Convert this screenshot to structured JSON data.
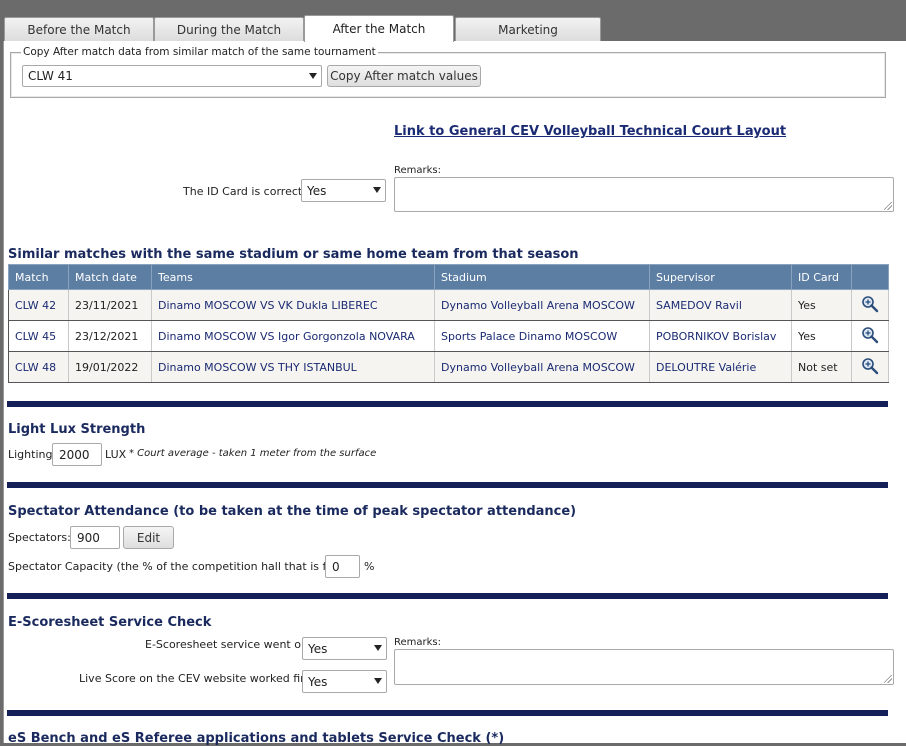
{
  "tabs": [
    {
      "label": "Before the Match"
    },
    {
      "label": "During the Match"
    },
    {
      "label": "After the Match"
    },
    {
      "label": "Marketing"
    }
  ],
  "copy_section": {
    "legend": "Copy After match data from similar match of the same tournament",
    "selected_match": "CLW 41",
    "button_label": "Copy After match values"
  },
  "court_layout_link": "Link to General CEV Volleyball Technical Court Layout",
  "id_card": {
    "label": "The ID Card is correct?",
    "value": "Yes",
    "remarks_label": "Remarks:"
  },
  "similar_matches": {
    "title": "Similar matches with the same stadium or same home team from that season",
    "columns": [
      "Match",
      "Match date",
      "Teams",
      "Stadium",
      "Supervisor",
      "ID Card"
    ],
    "rows": [
      {
        "match": "CLW 42",
        "date": "23/11/2021",
        "teams": "Dinamo MOSCOW VS VK Dukla LIBEREC",
        "stadium": "Dynamo Volleyball Arena MOSCOW",
        "supervisor": "SAMEDOV Ravil",
        "id_card": "Yes"
      },
      {
        "match": "CLW 45",
        "date": "23/12/2021",
        "teams": "Dinamo MOSCOW VS Igor Gorgonzola NOVARA",
        "stadium": "Sports Palace Dinamo MOSCOW",
        "supervisor": "POBORNIKOV Borislav",
        "id_card": "Yes"
      },
      {
        "match": "CLW 48",
        "date": "19/01/2022",
        "teams": "Dinamo MOSCOW VS THY ISTANBUL",
        "stadium": "Dynamo Volleyball Arena MOSCOW",
        "supervisor": "DELOUTRE Valérie",
        "id_card": "Not set"
      }
    ]
  },
  "light": {
    "title": "Light Lux Strength",
    "label": "Lighting",
    "value": "2000",
    "unit": "LUX",
    "note": "* Court average - taken 1 meter from the surface"
  },
  "spectators": {
    "title": "Spectator Attendance (to be taken at the time of peak spectator attendance)",
    "label": "Spectators:",
    "value": "900",
    "edit_label": "Edit",
    "capacity_label": "Spectator Capacity (the % of the competition hall that is full):",
    "capacity_value": "0",
    "capacity_unit": "%"
  },
  "escoresheet": {
    "title": "E-Scoresheet Service Check",
    "service_label": "E-Scoresheet service went ok:",
    "service_value": "Yes",
    "livescore_label": "Live Score on the CEV website worked fine:",
    "livescore_value": "Yes",
    "remarks_label": "Remarks:"
  },
  "esbench": {
    "title": "eS Bench and eS Referee applications and tablets Service Check (*)"
  },
  "colors": {
    "header_blue": "#5d7ea3",
    "divider_navy": "#142057",
    "title_navy": "#1a2a5e"
  }
}
